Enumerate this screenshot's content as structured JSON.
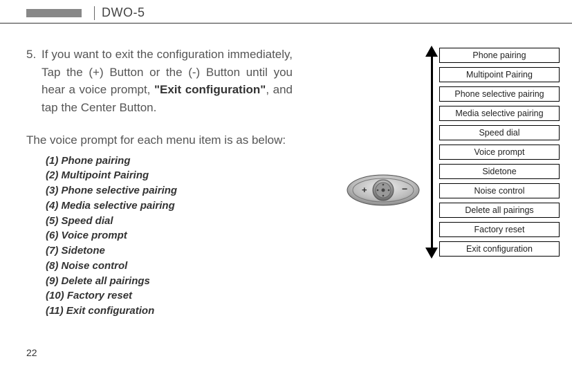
{
  "header": {
    "model": "DWO-5"
  },
  "step": {
    "number": "5.",
    "text_prefix": "If you want to exit the configuration immediately, Tap the (+) Button or the (-) Button until you hear a voice prompt, ",
    "text_bold": "\"Exit configuration\"",
    "text_suffix": ", and tap the Center Button."
  },
  "subhead": "The voice prompt for each menu item is as below:",
  "list": [
    "(1) Phone pairing",
    "(2) Multipoint Pairing",
    "(3) Phone selective pairing",
    "(4) Media selective pairing",
    "(5) Speed dial",
    "(6) Voice prompt",
    "(7) Sidetone",
    "(8) Noise control",
    "(9) Delete all pairings",
    "(10) Factory reset",
    "(11) Exit configuration"
  ],
  "menu": [
    "Phone pairing",
    "Multipoint Pairing",
    "Phone selective pairing",
    "Media selective pairing",
    "Speed dial",
    "Voice prompt",
    "Sidetone",
    "Noise control",
    "Delete all pairings",
    "Factory reset",
    "Exit configuration"
  ],
  "page_number": "22"
}
